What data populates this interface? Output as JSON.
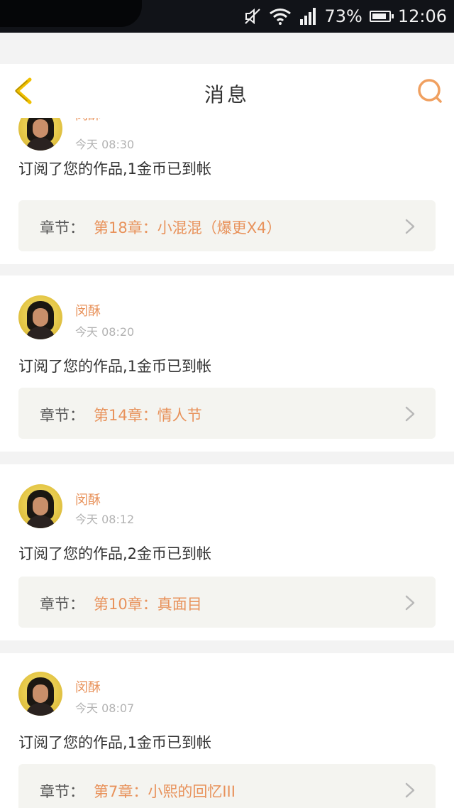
{
  "status_bar": {
    "battery": "73%",
    "time": "12:06"
  },
  "nav": {
    "title": "消息",
    "back_icon": "chevron-left-icon",
    "search_icon": "search-icon",
    "accent_back": "#f0c000",
    "accent_search": "#f0a060"
  },
  "messages": [
    {
      "username": "闵酥",
      "time": "今天 08:30",
      "text": "订阅了您的作品,1金币已到帐",
      "chapter_label": "章节：",
      "chapter": "第18章：小混混（爆更X4）"
    },
    {
      "username": "闵酥",
      "time": "今天 08:20",
      "text": "订阅了您的作品,1金币已到帐",
      "chapter_label": "章节：",
      "chapter": "第14章：情人节"
    },
    {
      "username": "闵酥",
      "time": "今天 08:12",
      "text": "订阅了您的作品,2金币已到帐",
      "chapter_label": "章节：",
      "chapter": "第10章：真面目"
    },
    {
      "username": "闵酥",
      "time": "今天 08:07",
      "text": "订阅了您的作品,1金币已到帐",
      "chapter_label": "章节：",
      "chapter": "第7章：小熙的回忆III"
    }
  ],
  "colors": {
    "accent_orange": "#e8925b",
    "status_bar_bg": "#111318"
  }
}
